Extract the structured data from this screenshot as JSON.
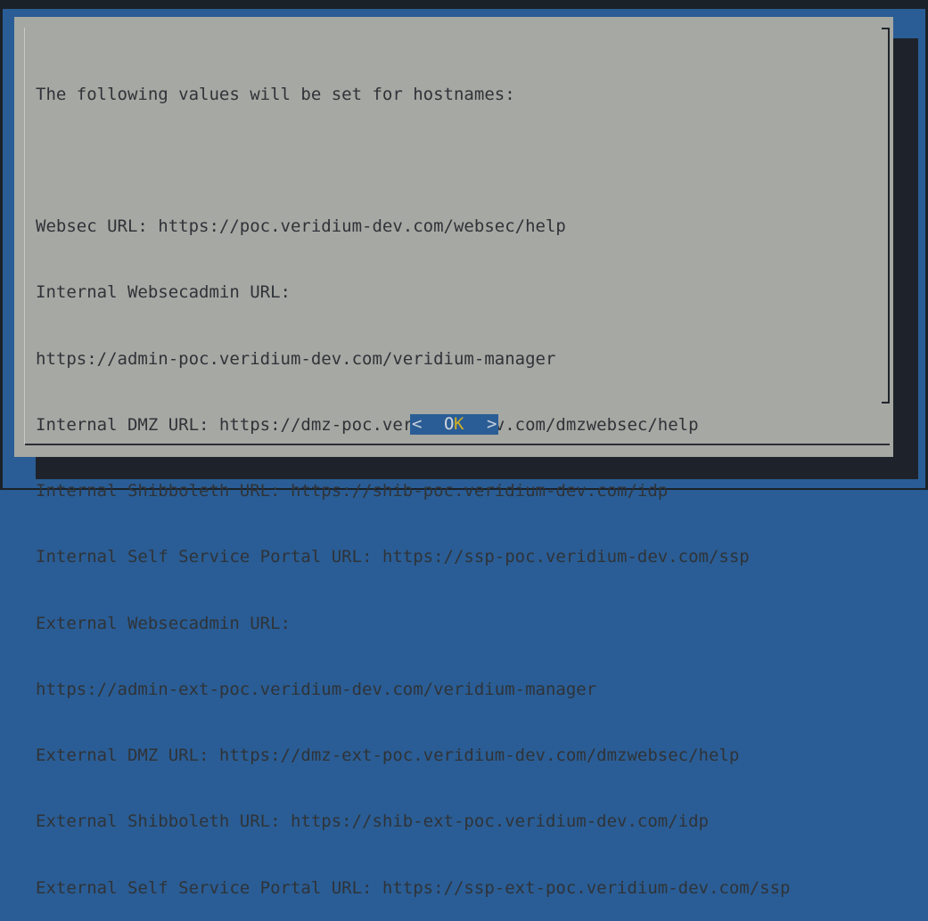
{
  "dialog": {
    "lines": [
      "The following values will be set for hostnames:",
      "",
      "Websec URL: https://poc.veridium-dev.com/websec/help",
      "Internal Websecadmin URL:",
      "https://admin-poc.veridium-dev.com/veridium-manager",
      "Internal DMZ URL: https://dmz-poc.veridium-dev.com/dmzwebsec/help",
      "Internal Shibboleth URL: https://shib-poc.veridium-dev.com/idp",
      "Internal Self Service Portal URL: https://ssp-poc.veridium-dev.com/ssp",
      "External Websecadmin URL:",
      "https://admin-ext-poc.veridium-dev.com/veridium-manager",
      "External DMZ URL: https://dmz-ext-poc.veridium-dev.com/dmzwebsec/help",
      "External Shibboleth URL: https://shib-ext-poc.veridium-dev.com/idp",
      "External Self Service Portal URL: https://ssp-ext-poc.veridium-dev.com/ssp"
    ],
    "ok_button": {
      "left_bracket": "<",
      "label_o": "O",
      "label_k": "K",
      "right_bracket": ">"
    }
  },
  "colors": {
    "background": "#2a5d95",
    "dialog": "#a6a8a3",
    "text": "#2f3338",
    "hotkey": "#d2b021"
  }
}
